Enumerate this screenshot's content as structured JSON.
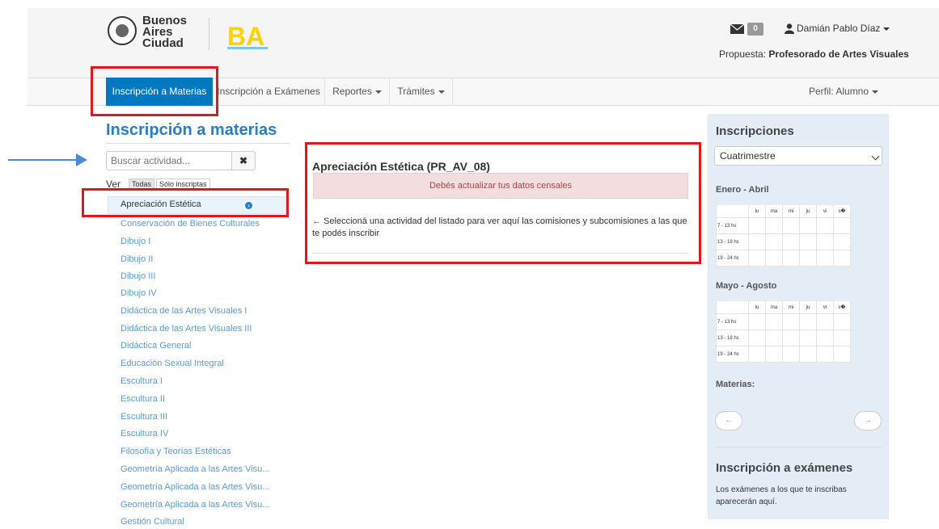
{
  "header": {
    "logo_text": [
      "Buenos",
      "Aires",
      "Ciudad"
    ],
    "logo_badge": "BA",
    "mail_count": "0",
    "user_name": "Damián Pablo Díaz",
    "propuesta_label": "Propuesta:",
    "propuesta_value": "Profesorado de Artes Visuales"
  },
  "nav": {
    "items": [
      "Inscripción a Materias",
      "Inscripción a Exámenes",
      "Reportes",
      "Trámites"
    ],
    "perfil": "Perfil: Alumno"
  },
  "left": {
    "title": "Inscripción a materias",
    "search_placeholder": "Buscar actividad...",
    "clear_icon": "✖",
    "ver_label": "Ver",
    "ver_options": [
      "Todas",
      "Sólo inscriptas"
    ],
    "selected_item": "Apreciación Estética",
    "items": [
      "Conservación de Bienes Culturales",
      "Dibujo I",
      "Dibujo II",
      "Dibujo III",
      "Dibujo IV",
      "Didáctica de las Artes Visuales I",
      "Didáctica de las Artes Visuales III",
      "Didáctica General",
      "Educación Sexual Integral",
      "Escultura I",
      "Escultura II",
      "Escultura III",
      "Escultura IV",
      "Filosofía y Teorías Estéticas",
      "Geometría Aplicada a las Artes Visu...",
      "Geometría Aplicada a las Artes Visu...",
      "Geometría Aplicada a las Artes Visu...",
      "Gestión Cultural"
    ]
  },
  "center": {
    "activity_title": "Apreciación Estética (PR_AV_08)",
    "alert": "Debés actualizar tus datos censales",
    "info": "← Seleccioná una actividad del listado para ver aquí las comisiones y subcomisiones a las que te podés inscribir"
  },
  "right": {
    "title": "Inscripciones",
    "period_select": "Cuatrimestre",
    "blocks": [
      {
        "label": "Enero - Abril"
      },
      {
        "label": "Mayo - Agosto"
      }
    ],
    "days": [
      "lu",
      "ma",
      "mi",
      "ju",
      "vi",
      "s�"
    ],
    "hours": [
      "7 - 13 hs",
      "13 - 19 hs",
      "19 - 24 hs"
    ],
    "materias_label": "Materias:",
    "prev": "←",
    "next": "→",
    "exams_title": "Inscripción a exámenes",
    "exams_text": "Los exámenes a los que te inscribas aparecerán aquí."
  },
  "colors": {
    "primary": "#0079c1",
    "link": "#5b9bd5",
    "title": "#2a7dc0",
    "highlight_box": "#e5151c",
    "annotation_arrow": "#4a8bd6"
  }
}
